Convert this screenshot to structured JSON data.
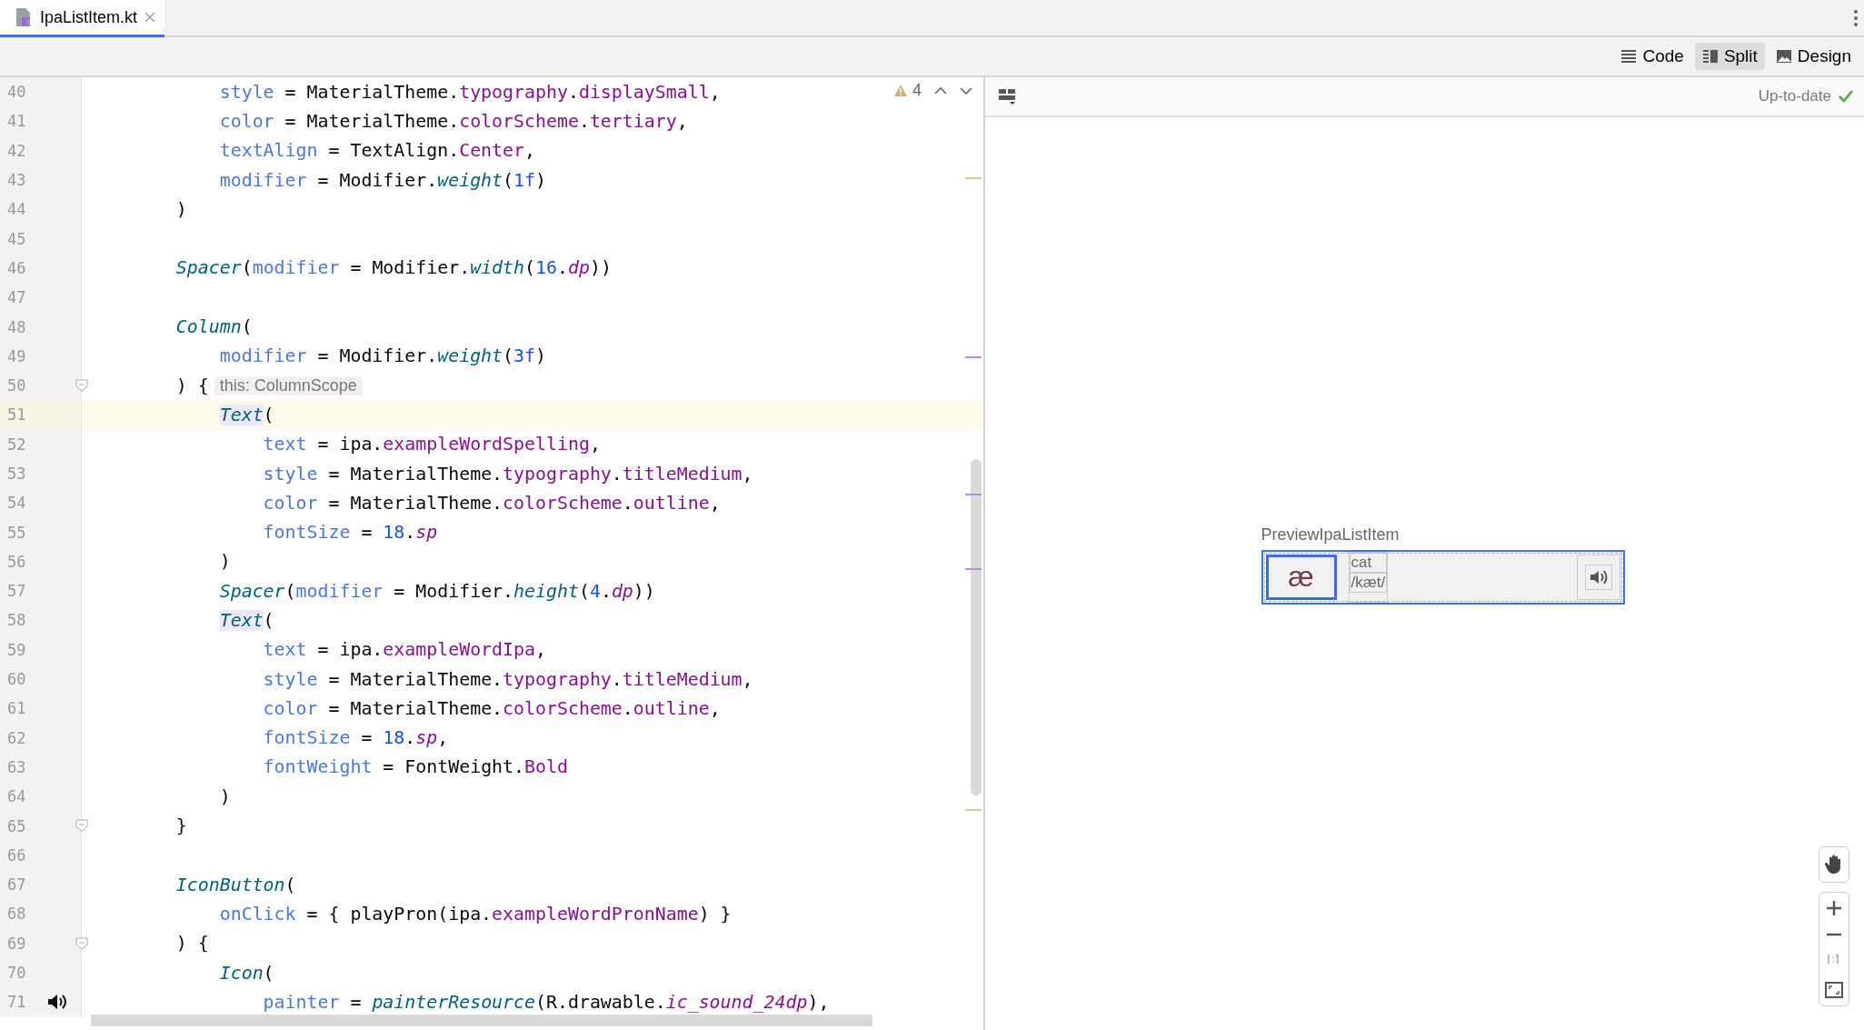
{
  "tabs": [
    {
      "label": "IpaListItem.kt",
      "selected": true
    }
  ],
  "view_modes": [
    {
      "label": "Code",
      "selected": false,
      "kind": "code"
    },
    {
      "label": "Split",
      "selected": true,
      "kind": "split"
    },
    {
      "label": "Design",
      "selected": false,
      "kind": "design"
    }
  ],
  "editor": {
    "problems": {
      "count": "4"
    },
    "lines": [
      {
        "number": "40",
        "current": false,
        "fold": false,
        "tokens": [
          {
            "text": "            style",
            "kind": "param"
          },
          {
            "text": " = MaterialTheme.",
            "kind": "plain"
          },
          {
            "text": "typography",
            "kind": "prop"
          },
          {
            "text": ".displaySmall",
            "kind": "dotted-prop"
          },
          {
            "text": ",",
            "kind": "plain"
          }
        ]
      },
      {
        "number": "41",
        "current": false,
        "fold": false,
        "tokens": [
          {
            "text": "            color",
            "kind": "param"
          },
          {
            "text": " = MaterialTheme.",
            "kind": "plain"
          },
          {
            "text": "colorScheme",
            "kind": "prop"
          },
          {
            "text": ".tertiary",
            "kind": "dotted-prop"
          },
          {
            "text": ",",
            "kind": "plain"
          }
        ]
      },
      {
        "number": "42",
        "current": false,
        "fold": false,
        "tokens": [
          {
            "text": "            textAlign",
            "kind": "param"
          },
          {
            "text": " = TextAlign.",
            "kind": "plain"
          },
          {
            "text": "Center",
            "kind": "prop"
          },
          {
            "text": ",",
            "kind": "plain"
          }
        ]
      },
      {
        "number": "43",
        "current": false,
        "fold": false,
        "tokens": [
          {
            "text": "            modifier",
            "kind": "param"
          },
          {
            "text": " = Modifier.",
            "kind": "plain"
          },
          {
            "text": "weight",
            "kind": "call"
          },
          {
            "text": "(",
            "kind": "plain"
          },
          {
            "text": "1f",
            "kind": "num"
          },
          {
            "text": ")",
            "kind": "plain"
          }
        ]
      },
      {
        "number": "44",
        "current": false,
        "fold": false,
        "tokens": [
          {
            "text": "        )",
            "kind": "plain"
          }
        ]
      },
      {
        "number": "45",
        "current": false,
        "fold": false
      },
      {
        "number": "46",
        "current": false,
        "fold": false,
        "tokens": [
          {
            "text": "        Spacer",
            "kind": "call"
          },
          {
            "text": "(",
            "kind": "plain"
          },
          {
            "text": "modifier",
            "kind": "param"
          },
          {
            "text": " = Modifier.",
            "kind": "plain"
          },
          {
            "text": "width",
            "kind": "call"
          },
          {
            "text": "(",
            "kind": "plain"
          },
          {
            "text": "16",
            "kind": "num"
          },
          {
            "text": ".",
            "kind": "plain"
          },
          {
            "text": "dp",
            "kind": "unit"
          },
          {
            "text": "))",
            "kind": "plain"
          }
        ]
      },
      {
        "number": "47",
        "current": false,
        "fold": false
      },
      {
        "number": "48",
        "current": false,
        "fold": false,
        "tokens": [
          {
            "text": "        Column",
            "kind": "call"
          },
          {
            "text": "(",
            "kind": "plain"
          }
        ]
      },
      {
        "number": "49",
        "current": false,
        "fold": false,
        "tokens": [
          {
            "text": "            modifier",
            "kind": "param"
          },
          {
            "text": " = Modifier.",
            "kind": "plain"
          },
          {
            "text": "weight",
            "kind": "call"
          },
          {
            "text": "(",
            "kind": "plain"
          },
          {
            "text": "3f",
            "kind": "num"
          },
          {
            "text": ")",
            "kind": "plain"
          }
        ]
      },
      {
        "number": "50",
        "current": false,
        "fold": true,
        "hint": "this: ColumnScope",
        "tokens": [
          {
            "text": "        ) {",
            "kind": "plain"
          }
        ]
      },
      {
        "number": "51",
        "current": true,
        "fold": false,
        "tokens": [
          {
            "text": "            Text",
            "kind": "call-match"
          },
          {
            "text": "(",
            "kind": "plain"
          }
        ]
      },
      {
        "number": "52",
        "current": false,
        "fold": false,
        "tokens": [
          {
            "text": "                text",
            "kind": "param"
          },
          {
            "text": " = ipa.",
            "kind": "plain"
          },
          {
            "text": "exampleWordSpelling",
            "kind": "prop"
          },
          {
            "text": ",",
            "kind": "plain"
          }
        ]
      },
      {
        "number": "53",
        "current": false,
        "fold": false,
        "tokens": [
          {
            "text": "                style",
            "kind": "param"
          },
          {
            "text": " = MaterialTheme.",
            "kind": "plain"
          },
          {
            "text": "typography",
            "kind": "prop"
          },
          {
            "text": ".titleMedium",
            "kind": "dotted-prop"
          },
          {
            "text": ",",
            "kind": "plain"
          }
        ]
      },
      {
        "number": "54",
        "current": false,
        "fold": false,
        "tokens": [
          {
            "text": "                color",
            "kind": "param"
          },
          {
            "text": " = MaterialTheme.",
            "kind": "plain"
          },
          {
            "text": "colorScheme",
            "kind": "prop"
          },
          {
            "text": ".outline",
            "kind": "dotted-prop"
          },
          {
            "text": ",",
            "kind": "plain"
          }
        ]
      },
      {
        "number": "55",
        "current": false,
        "fold": false,
        "tokens": [
          {
            "text": "                fontSize",
            "kind": "param"
          },
          {
            "text": " = ",
            "kind": "plain"
          },
          {
            "text": "18",
            "kind": "num"
          },
          {
            "text": ".",
            "kind": "plain"
          },
          {
            "text": "sp",
            "kind": "unit"
          }
        ]
      },
      {
        "number": "56",
        "current": false,
        "fold": false,
        "tokens": [
          {
            "text": "            )",
            "kind": "plain"
          }
        ]
      },
      {
        "number": "57",
        "current": false,
        "fold": false,
        "tokens": [
          {
            "text": "            Spacer",
            "kind": "call"
          },
          {
            "text": "(",
            "kind": "plain"
          },
          {
            "text": "modifier",
            "kind": "param"
          },
          {
            "text": " = Modifier.",
            "kind": "plain"
          },
          {
            "text": "height",
            "kind": "call"
          },
          {
            "text": "(",
            "kind": "plain"
          },
          {
            "text": "4",
            "kind": "num"
          },
          {
            "text": ".",
            "kind": "plain"
          },
          {
            "text": "dp",
            "kind": "unit"
          },
          {
            "text": "))",
            "kind": "plain"
          }
        ]
      },
      {
        "number": "58",
        "current": false,
        "fold": false,
        "tokens": [
          {
            "text": "            Text",
            "kind": "call-match"
          },
          {
            "text": "(",
            "kind": "plain"
          }
        ]
      },
      {
        "number": "59",
        "current": false,
        "fold": false,
        "tokens": [
          {
            "text": "                text",
            "kind": "param"
          },
          {
            "text": " = ipa.",
            "kind": "plain"
          },
          {
            "text": "exampleWordIpa",
            "kind": "prop"
          },
          {
            "text": ",",
            "kind": "plain"
          }
        ]
      },
      {
        "number": "60",
        "current": false,
        "fold": false,
        "tokens": [
          {
            "text": "                style",
            "kind": "param"
          },
          {
            "text": " = MaterialTheme.",
            "kind": "plain"
          },
          {
            "text": "typography",
            "kind": "prop"
          },
          {
            "text": ".titleMedium",
            "kind": "dotted-prop"
          },
          {
            "text": ",",
            "kind": "plain"
          }
        ]
      },
      {
        "number": "61",
        "current": false,
        "fold": false,
        "tokens": [
          {
            "text": "                color",
            "kind": "param"
          },
          {
            "text": " = MaterialTheme.",
            "kind": "plain"
          },
          {
            "text": "colorScheme",
            "kind": "prop"
          },
          {
            "text": ".outline",
            "kind": "dotted-prop"
          },
          {
            "text": ",",
            "kind": "plain"
          }
        ]
      },
      {
        "number": "62",
        "current": false,
        "fold": false,
        "tokens": [
          {
            "text": "                fontSize",
            "kind": "param"
          },
          {
            "text": " = ",
            "kind": "plain"
          },
          {
            "text": "18",
            "kind": "num"
          },
          {
            "text": ".",
            "kind": "plain"
          },
          {
            "text": "sp",
            "kind": "unit"
          },
          {
            "text": ",",
            "kind": "plain"
          }
        ]
      },
      {
        "number": "63",
        "current": false,
        "fold": false,
        "tokens": [
          {
            "text": "                fontWeight",
            "kind": "param"
          },
          {
            "text": " = FontWeight.",
            "kind": "plain"
          },
          {
            "text": "Bold",
            "kind": "prop"
          }
        ]
      },
      {
        "number": "64",
        "current": false,
        "fold": false,
        "tokens": [
          {
            "text": "            )",
            "kind": "plain"
          }
        ]
      },
      {
        "number": "65",
        "current": false,
        "fold": true,
        "tokens": [
          {
            "text": "        }",
            "kind": "plain"
          }
        ]
      },
      {
        "number": "66",
        "current": false,
        "fold": false
      },
      {
        "number": "67",
        "current": false,
        "fold": false,
        "tokens": [
          {
            "text": "        IconButton",
            "kind": "call"
          },
          {
            "text": "(",
            "kind": "plain"
          }
        ]
      },
      {
        "number": "68",
        "current": false,
        "fold": false,
        "tokens": [
          {
            "text": "            onClick",
            "kind": "param"
          },
          {
            "text": " = { playPron(ipa.",
            "kind": "plain"
          },
          {
            "text": "exampleWordPronName",
            "kind": "prop"
          },
          {
            "text": ") }",
            "kind": "plain"
          }
        ]
      },
      {
        "number": "69",
        "current": false,
        "fold": true,
        "tokens": [
          {
            "text": "        ) {",
            "kind": "plain"
          }
        ]
      },
      {
        "number": "70",
        "current": false,
        "fold": false,
        "tokens": [
          {
            "text": "            Icon",
            "kind": "call"
          },
          {
            "text": "(",
            "kind": "plain"
          }
        ]
      },
      {
        "number": "71",
        "current": false,
        "fold": false,
        "speaker_icon": true,
        "tokens": [
          {
            "text": "                painter",
            "kind": "param"
          },
          {
            "text": " = ",
            "kind": "plain"
          },
          {
            "text": "painterResource",
            "kind": "call"
          },
          {
            "text": "(R.drawable.",
            "kind": "plain"
          },
          {
            "text": "ic_sound_24dp",
            "kind": "static"
          },
          {
            "text": "),",
            "kind": "plain"
          }
        ]
      }
    ]
  },
  "preview": {
    "status": "Up-to-date",
    "name": "PreviewIpaListItem",
    "item": {
      "symbol": "æ",
      "spelling": "cat",
      "ipa": "/kæt/"
    }
  }
}
